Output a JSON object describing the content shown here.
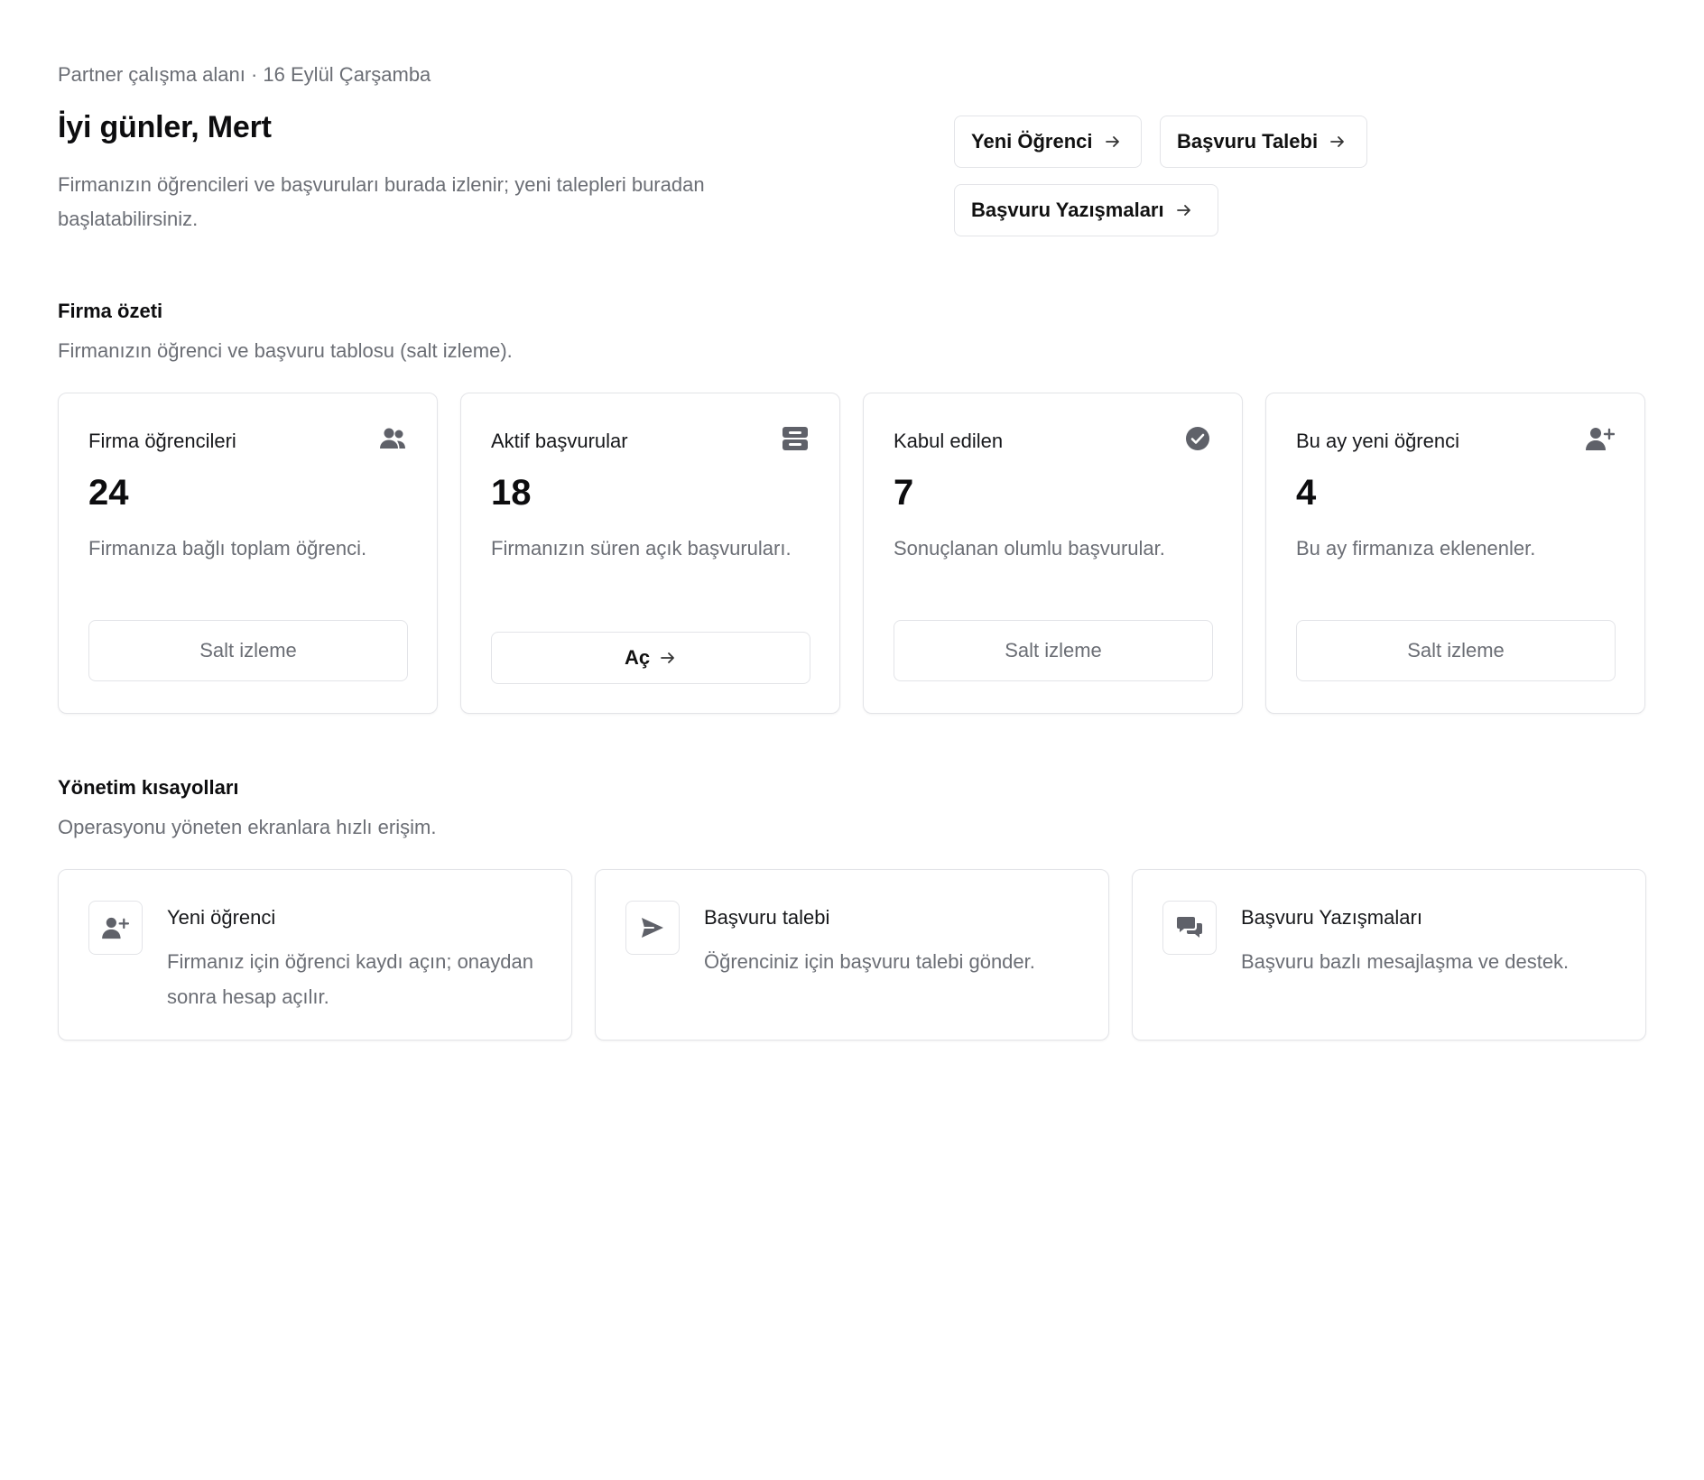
{
  "header": {
    "eyebrow": "Partner çalışma alanı · 16 Eylül Çarşamba",
    "greeting": "İyi günler, Mert",
    "intro": "Firmanızın öğrencileri ve başvuruları burada izlenir; yeni talepleri buradan başlatabilirsiniz.",
    "actions": {
      "new_student": "Yeni Öğrenci",
      "application_request": "Başvuru Talebi",
      "application_messages": "Başvuru Yazışmaları"
    }
  },
  "summary": {
    "title": "Firma özeti",
    "description": "Firmanızın öğrenci ve başvuru tablosu (salt izleme).",
    "cards": [
      {
        "label": "Firma öğrencileri",
        "icon": "users-icon",
        "value": "24",
        "description": "Firmanıza bağlı toplam öğrenci.",
        "button": "Salt izleme"
      },
      {
        "label": "Aktif başvurular",
        "icon": "inbox-icon",
        "value": "18",
        "description": "Firmanızın süren açık başvuruları.",
        "button": "Aç"
      },
      {
        "label": "Kabul edilen",
        "icon": "check-circle-icon",
        "value": "7",
        "description": "Sonuçlanan olumlu başvurular.",
        "button": "Salt izleme"
      },
      {
        "label": "Bu ay yeni öğrenci",
        "icon": "user-plus-icon",
        "value": "4",
        "description": "Bu ay firmanıza eklenenler.",
        "button": "Salt izleme"
      }
    ]
  },
  "shortcuts": {
    "title": "Yönetim kısayolları",
    "description": "Operasyonu yöneten ekranlara hızlı erişim.",
    "items": [
      {
        "title": "Yeni öğrenci",
        "icon": "user-plus-icon",
        "description": "Firmanız için öğrenci kaydı açın; onaydan sonra hesap açılır."
      },
      {
        "title": "Başvuru talebi",
        "icon": "send-icon",
        "description": "Öğrenciniz için başvuru talebi gönder."
      },
      {
        "title": "Başvuru Yazışmaları",
        "icon": "chat-icon",
        "description": "Başvuru bazlı mesajlaşma ve destek."
      }
    ]
  }
}
